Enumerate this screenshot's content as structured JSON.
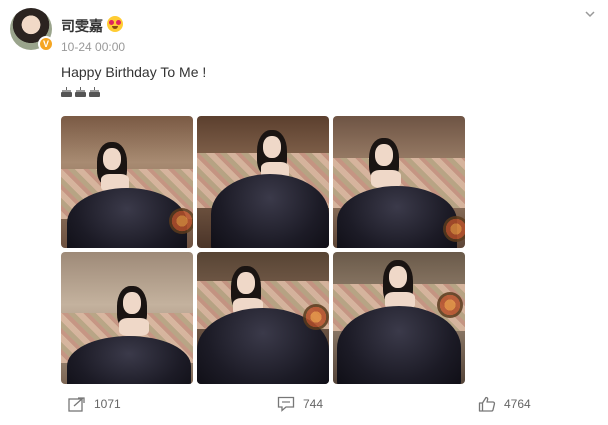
{
  "user": {
    "name": "司雯嘉",
    "verified_badge": "V"
  },
  "post": {
    "timestamp": "10-24 00:00",
    "text": "Happy Birthday To Me !",
    "emoji_line": [
      "cake-icon",
      "cake-icon",
      "cake-icon"
    ],
    "photos": [
      {
        "name": "photo-1"
      },
      {
        "name": "photo-2"
      },
      {
        "name": "photo-3"
      },
      {
        "name": "photo-4"
      },
      {
        "name": "photo-5"
      },
      {
        "name": "photo-6"
      }
    ]
  },
  "actions": {
    "repost_count": "1071",
    "comment_count": "744",
    "like_count": "4764"
  },
  "colors": {
    "text": "#333333",
    "muted": "#999999",
    "badge": "#f5a623"
  }
}
